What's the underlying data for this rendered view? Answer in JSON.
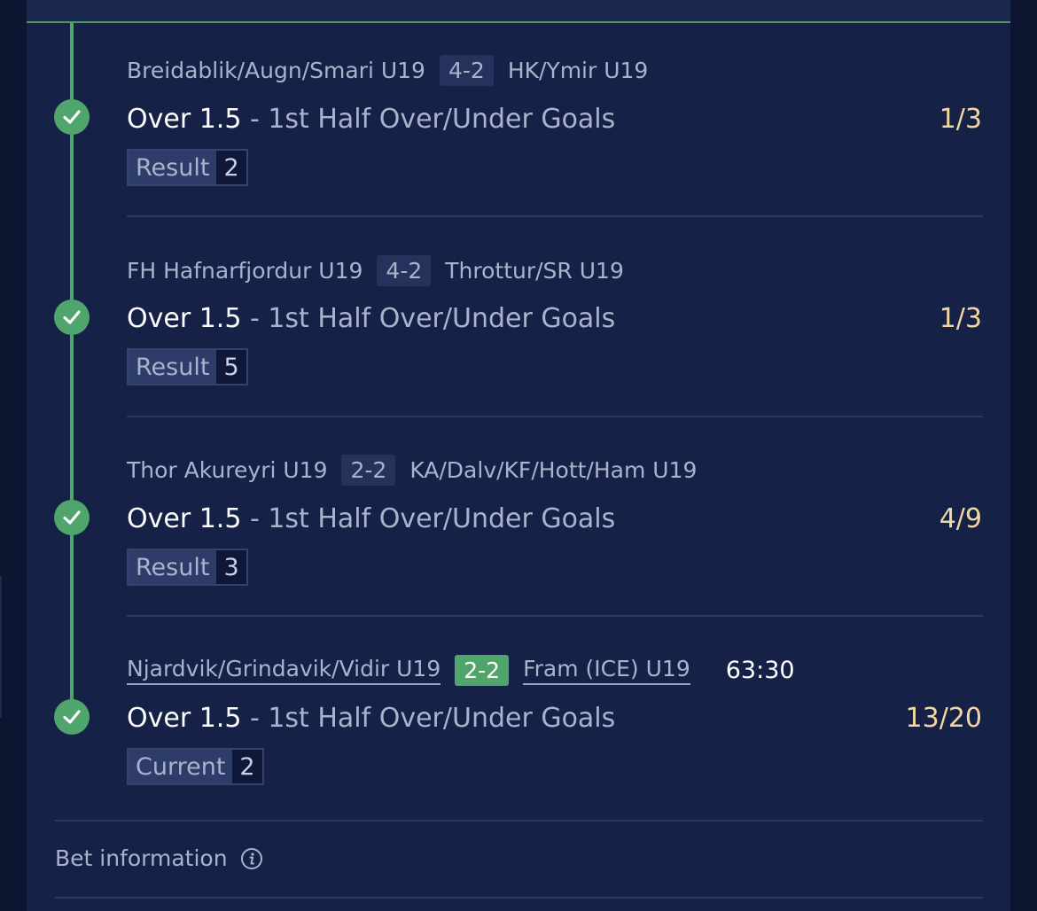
{
  "selections": [
    {
      "home": "Breidablik/Augn/Smari U19",
      "score": "4-2",
      "away": "HK/Ymir U19",
      "pick": "Over 1.5",
      "separator": "-",
      "market": "1st Half Over/Under Goals",
      "odds": "1/3",
      "result_label": "Result",
      "result_value": "2"
    },
    {
      "home": "FH Hafnarfjordur U19",
      "score": "4-2",
      "away": "Throttur/SR U19",
      "pick": "Over 1.5",
      "separator": "-",
      "market": "1st Half Over/Under Goals",
      "odds": "1/3",
      "result_label": "Result",
      "result_value": "5"
    },
    {
      "home": "Thor Akureyri U19",
      "score": "2-2",
      "away": "KA/Dalv/KF/Hott/Ham U19",
      "pick": "Over 1.5",
      "separator": "-",
      "market": "1st Half Over/Under Goals",
      "odds": "4/9",
      "result_label": "Result",
      "result_value": "3"
    },
    {
      "home": "Njardvik/Grindavik/Vidir U19",
      "score": "2-2",
      "away": "Fram (ICE) U19",
      "clock": "63:30",
      "pick": "Over 1.5",
      "separator": "-",
      "market": "1st Half Over/Under Goals",
      "odds": "13/20",
      "result_label": "Current",
      "result_value": "2"
    }
  ],
  "footer": {
    "bet_information_label": "Bet information"
  },
  "icons": {
    "status": "check-icon",
    "info": "info-icon"
  },
  "colors": {
    "background": "#152146",
    "accent_green": "#4fa56b",
    "odds": "#f2d8a0",
    "muted_text": "#a9b3cc"
  }
}
